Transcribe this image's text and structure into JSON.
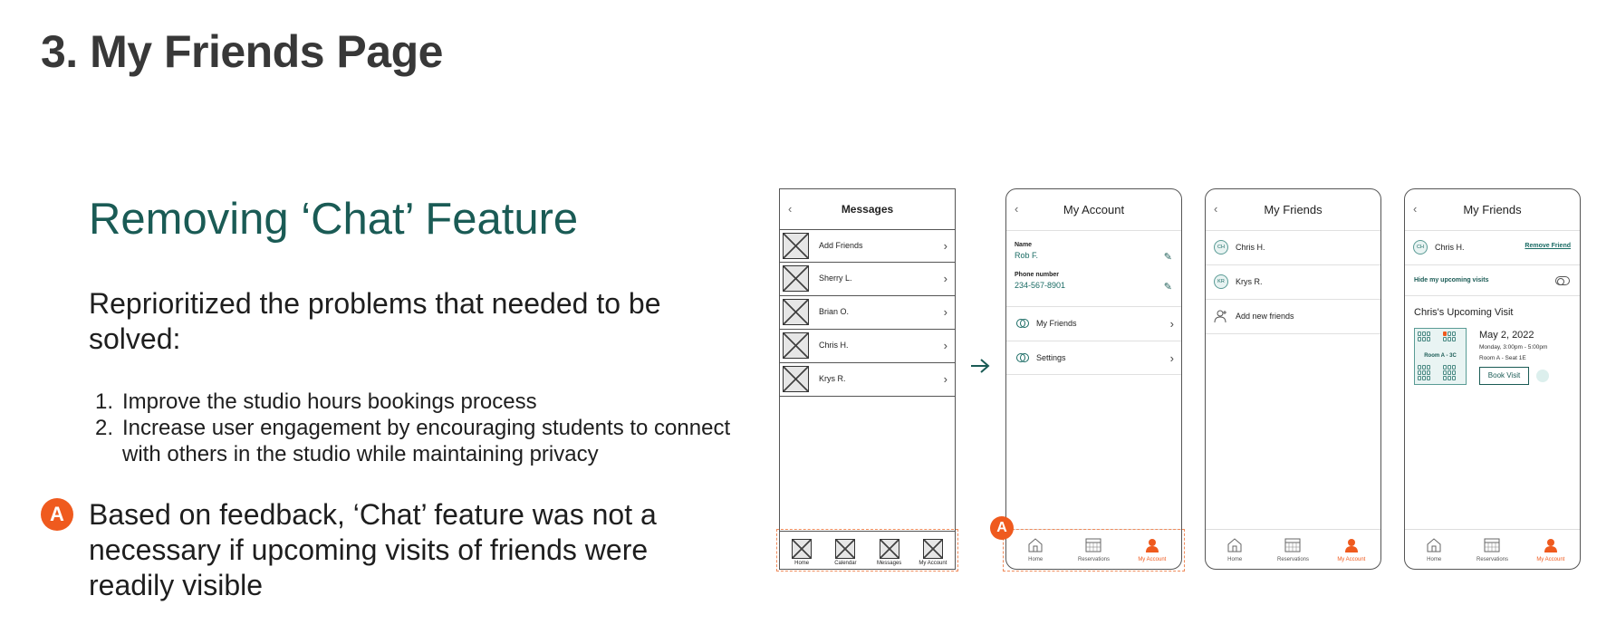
{
  "page": {
    "title": "3. My Friends Page",
    "heading": "Removing ‘Chat’ Feature",
    "intro": "Reprioritized the problems that needed to be solved:",
    "problems": [
      "Improve the studio hours bookings process",
      "Increase user engagement by encouraging students to connect with others in the studio while maintaining privacy"
    ],
    "badge": "A",
    "feedback": "Based on feedback, ‘Chat’ feature was not a necessary if upcoming visits of friends were readily visible"
  },
  "colors": {
    "accent": "#ef5a1e",
    "primary": "#1a5b55"
  },
  "wireframe": {
    "title": "Messages",
    "rows": [
      "Add Friends",
      "Sherry L.",
      "Brian O.",
      "Chris H.",
      "Krys R."
    ],
    "nav": [
      "Home",
      "Calendar",
      "Messages",
      "My Account"
    ]
  },
  "account": {
    "title": "My Account",
    "name_label": "Name",
    "name_value": "Rob F.",
    "phone_label": "Phone number",
    "phone_value": "234-567-8901",
    "menu": [
      "My Friends",
      "Settings"
    ],
    "badge": "A"
  },
  "friends": {
    "title": "My Friends",
    "list": [
      {
        "initials": "CH",
        "name": "Chris H."
      },
      {
        "initials": "KR",
        "name": "Krys R."
      }
    ],
    "add_label": "Add new friends"
  },
  "detail": {
    "title": "My Friends",
    "initials": "CH",
    "name": "Chris H.",
    "remove_label": "Remove Friend",
    "hide_label": "Hide my upcoming visits",
    "visit_heading": "Chris's Upcoming Visit",
    "room_label": "Room A - 3C",
    "date": "May 2, 2022",
    "time": "Monday, 3:00pm - 5:00pm",
    "room_seat": "Room A - Seat 1E",
    "book_label": "Book Visit"
  },
  "nav": [
    "Home",
    "Reservations",
    "My Account"
  ]
}
